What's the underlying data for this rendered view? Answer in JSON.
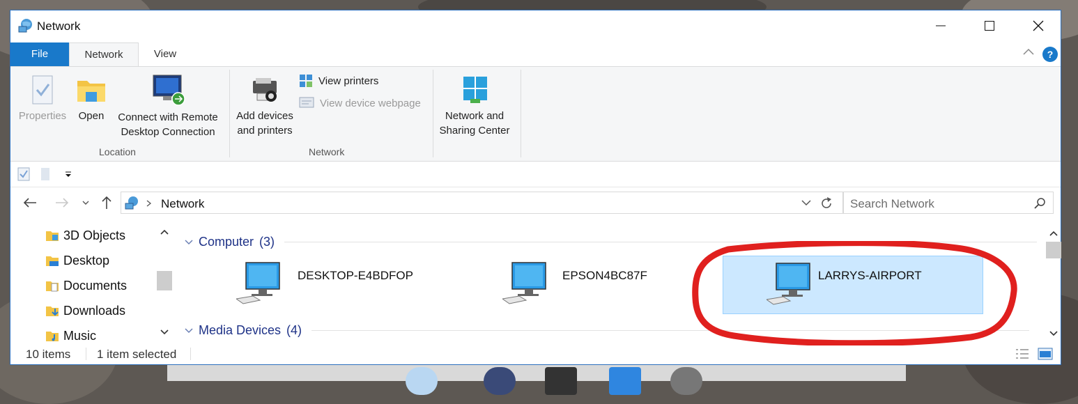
{
  "window": {
    "title": "Network"
  },
  "tabs": {
    "file": "File",
    "network": "Network",
    "view": "View"
  },
  "ribbon": {
    "properties": "Properties",
    "open": "Open",
    "remote_line1": "Connect with Remote",
    "remote_line2": "Desktop Connection",
    "location_group": "Location",
    "add_line1": "Add devices",
    "add_line2": "and printers",
    "view_printers": "View printers",
    "view_webpage": "View device webpage",
    "network_group": "Network",
    "nsc_line1": "Network and",
    "nsc_line2": "Sharing Center",
    "help": "?"
  },
  "address": {
    "path": "Network",
    "search_placeholder": "Search Network"
  },
  "nav_pane": {
    "items": [
      {
        "label": "3D Objects",
        "icon": "3d-objects-folder-icon"
      },
      {
        "label": "Desktop",
        "icon": "desktop-folder-icon"
      },
      {
        "label": "Documents",
        "icon": "documents-folder-icon"
      },
      {
        "label": "Downloads",
        "icon": "downloads-folder-icon"
      },
      {
        "label": "Music",
        "icon": "music-folder-icon"
      }
    ]
  },
  "content": {
    "groups": [
      {
        "name": "Computer",
        "count": "(3)"
      },
      {
        "name": "Media Devices",
        "count": "(4)"
      }
    ],
    "computers": [
      {
        "name": "DESKTOP-E4BDFOP",
        "selected": false
      },
      {
        "name": "EPSON4BC87F",
        "selected": false
      },
      {
        "name": "LARRYS-AIRPORT",
        "selected": true
      }
    ]
  },
  "status": {
    "count": "10 items",
    "selected": "1 item selected"
  },
  "colors": {
    "accent": "#1979ca",
    "selection": "#cce8ff",
    "annotation": "#e0201e",
    "group_header": "#1e3287"
  }
}
